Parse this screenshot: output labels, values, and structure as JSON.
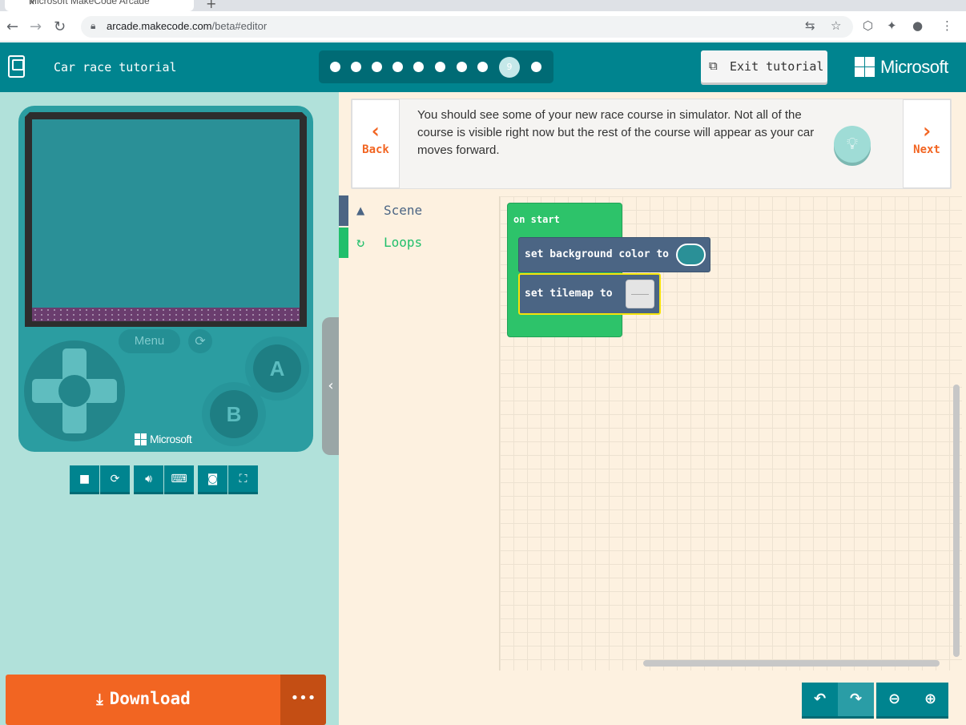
{
  "browser": {
    "tab_title": "Microsoft MakeCode Arcade",
    "url_host": "arcade.makecode.com",
    "url_path": "/beta#editor"
  },
  "header": {
    "title": "Car race tutorial",
    "current_step": "9",
    "total_steps": 10,
    "exit_label": "Exit tutorial",
    "brand": "Microsoft"
  },
  "instruction": {
    "back_label": "Back",
    "next_label": "Next",
    "text": "You should see some of your new race course in simulator. Not all of the course is visible right now but the rest of the course will appear as your car moves forward."
  },
  "toolbox": {
    "categories": [
      {
        "label": "Scene",
        "color": "#4b6584"
      },
      {
        "label": "Loops",
        "color": "#20bf6b"
      }
    ]
  },
  "simulator": {
    "menu_label": "Menu",
    "a_label": "A",
    "b_label": "B",
    "brand": "Microsoft"
  },
  "blocks": {
    "on_start": "on start",
    "set_background": "set background color to",
    "set_tilemap": "set tilemap to"
  },
  "download": {
    "label": "Download",
    "more": "•••"
  },
  "colors": {
    "topbar": "#00848f",
    "accent_orange": "#f26522",
    "background_color_value": "#2a9097"
  }
}
